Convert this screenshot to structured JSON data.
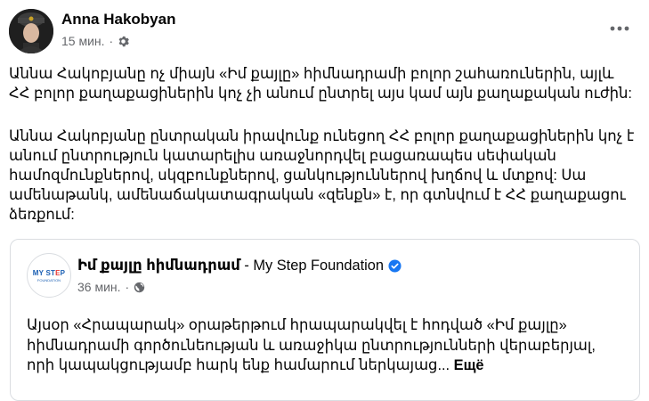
{
  "post": {
    "author": "Anna Hakobyan",
    "time": "15 мин.",
    "separator": "·",
    "paragraphs": [
      "Աննա Հակոբյանը ոչ միայն «Իմ քայլը» հիմնադրամի բոլոր շահառուներին, այլև ՀՀ բոլոր քաղաքացիներին կոչ չի անում ընտրել այս կամ այն քաղաքական ուժին:",
      "Աննա Հակոբյանը  ընտրական իրավունք ունեցող ՀՀ բոլոր  քաղաքացիներին կոչ է անում ընտրություն կատարելիս առաջնորդվել բացառապես սեփական համոզմունքներով, սկզբունքներով, ցանկություններով խղճով և մտքով: Սա ամենաթանկ, ամենաճակատագրական «զենքն» է, որ գտնվում է ՀՀ քաղաքացու ձեռքում:"
    ]
  },
  "shared": {
    "page_name": "Իմ քայլը հիմնադրամ",
    "page_suffix": " - My Step Foundation",
    "time": "36 мин.",
    "separator": "·",
    "text": "Այսօր «Հրապարակ» օրաթերթում հրապարակվել է հոդված «Իմ քայլը» հիմնադրամի գործունեության և առաջիկա ընտրությունների վերաբերյալ, որի կապակցությամբ հարկ ենք համարում ներկայաց...",
    "see_more": "Ещё",
    "logo_main_a": "MY ST",
    "logo_main_b": "E",
    "logo_main_c": "P",
    "logo_sub": "FOUNDATION"
  },
  "colors": {
    "text_primary": "#050505",
    "text_secondary": "#65676b",
    "verified_badge": "#1877f2",
    "logo_blue": "#1b5fb3",
    "logo_red": "#e53935"
  },
  "icons": {
    "audience": "gear-icon",
    "shared_audience": "globe-icon",
    "more": "more-horizontal-icon",
    "verified": "verified-badge-icon"
  }
}
